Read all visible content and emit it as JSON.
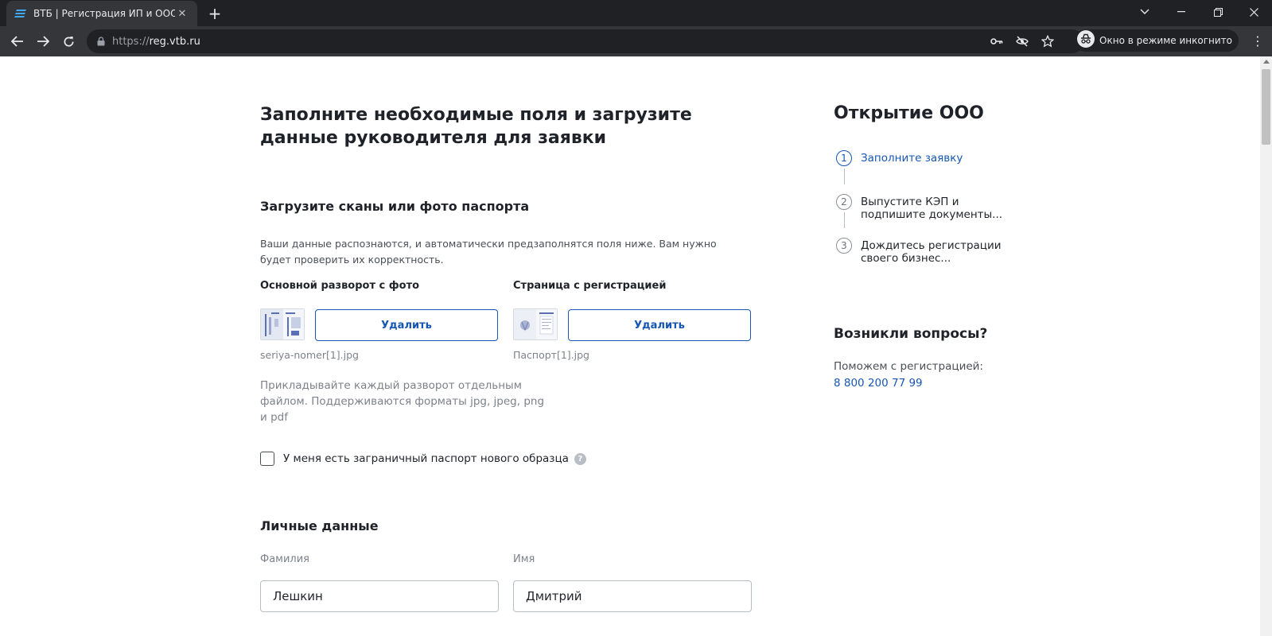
{
  "browser": {
    "tab_title": "ВТБ | Регистрация ИП и ООО",
    "url_scheme": "https://",
    "url_host": "reg.vtb.ru",
    "incognito_label": "Окно в режиме инкогнито"
  },
  "colors": {
    "brand_blue": "#1656b4",
    "text_primary": "#1f2329",
    "text_secondary": "#7d828a",
    "chrome_dark": "#202124",
    "chrome_toolbar": "#35363a"
  },
  "form": {
    "title": "Заполните необходимые поля и загрузите данные руководителя для заявки",
    "passport": {
      "title": "Загрузите сканы или фото паспорта",
      "description": "Ваши данные распознаются, и автоматически предзаполнятся поля ниже. Вам нужно будет проверить их корректность.",
      "main_spread": {
        "label": "Основной разворот с фото",
        "button": "Удалить",
        "filename": "seriya-nomer[1].jpg"
      },
      "registration_page": {
        "label": "Страница с регистрацией",
        "button": "Удалить",
        "filename": "Паспорт[1].jpg"
      },
      "hint": "Прикладывайте каждый разворот отдельным файлом. Поддерживаются форматы jpg, jpeg, png и pdf",
      "foreign_passport_checkbox": "У меня есть заграничный паспорт нового образца",
      "help": "?"
    },
    "personal": {
      "title": "Личные данные",
      "surname_label": "Фамилия",
      "surname_value": "Лешкин",
      "name_label": "Имя",
      "name_value": "Дмитрий"
    }
  },
  "sidebar": {
    "title": "Открытие ООО",
    "steps": [
      {
        "num": "1",
        "text": "Заполните заявку"
      },
      {
        "num": "2",
        "text": "Выпустите КЭП и подпишите документы..."
      },
      {
        "num": "3",
        "text": "Дождитесь регистрации своего бизнес..."
      }
    ],
    "questions_title": "Возникли вопросы?",
    "questions_text": "Поможем с регистрацией:",
    "phone": "8 800 200 77 99"
  }
}
